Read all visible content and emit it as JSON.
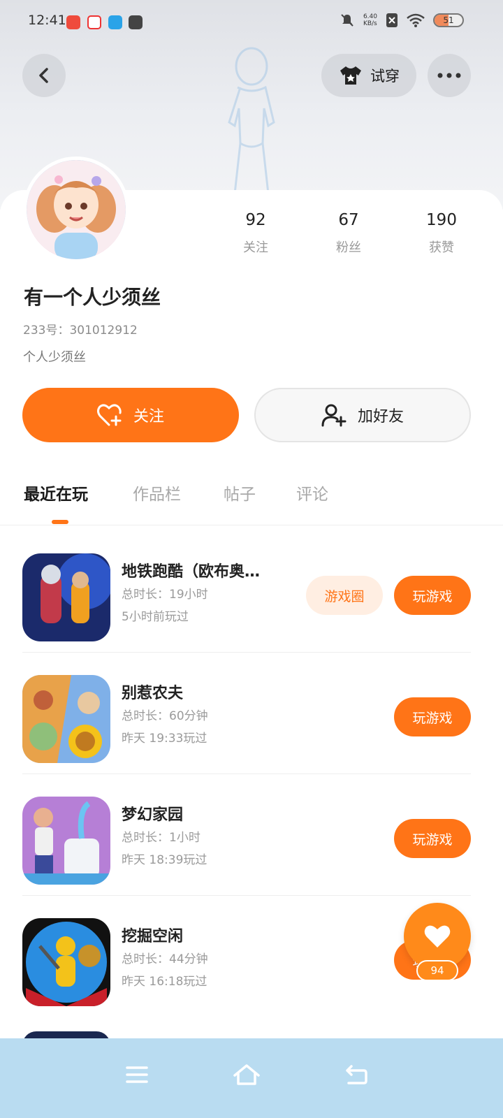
{
  "status_bar": {
    "time": "12:41",
    "network_speed": "6.40\nKB/s",
    "battery": "51"
  },
  "header": {
    "try_on_label": "试穿"
  },
  "profile": {
    "name": "有一个人少须丝",
    "uid": "233号：301012912",
    "bio": "个人少须丝",
    "stats": [
      {
        "value": "92",
        "label": "关注"
      },
      {
        "value": "67",
        "label": "粉丝"
      },
      {
        "value": "190",
        "label": "获赞"
      }
    ]
  },
  "actions": {
    "follow_label": "关注",
    "add_friend_label": "加好友"
  },
  "tabs": [
    "最近在玩",
    "作品栏",
    "帖子",
    "评论"
  ],
  "games": [
    {
      "title": "地铁跑酷（欧布奥…",
      "duration": "总时长：19小时",
      "last_played": "5小时前玩过",
      "circle_label": "游戏圈",
      "play_label": "玩游戏",
      "icon": "subway-surfers-icon"
    },
    {
      "title": "别惹农夫",
      "duration": "总时长：60分钟",
      "last_played": "昨天 19:33玩过",
      "play_label": "玩游戏",
      "icon": "plants-vs-zombies-icon"
    },
    {
      "title": "梦幻家园",
      "duration": "总时长：1小时",
      "last_played": "昨天 18:39玩过",
      "play_label": "玩游戏",
      "icon": "homescapes-icon"
    },
    {
      "title": "挖掘空闲",
      "duration": "总时长：44分钟",
      "last_played": "昨天 16:18玩过",
      "play_label": "玩游戏",
      "icon": "dig-idle-icon"
    }
  ],
  "like_fab": {
    "count": "94"
  },
  "colors": {
    "accent": "#ff7417",
    "nav_bg": "#b9dcf1"
  }
}
